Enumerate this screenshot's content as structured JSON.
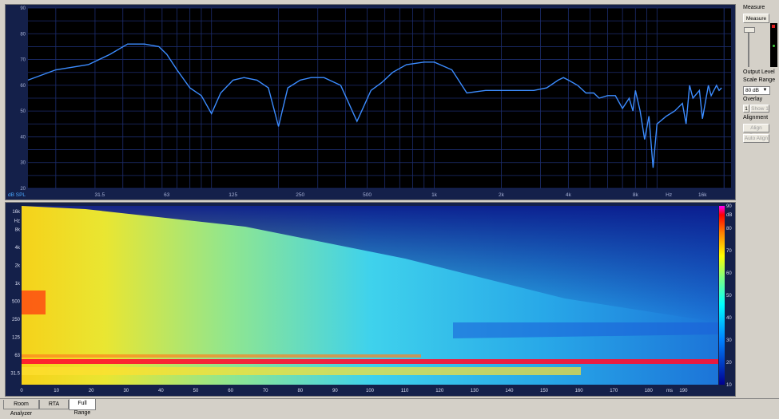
{
  "frequency_chart": {
    "ylabel": "dB SPL",
    "y_ticks": [
      "90",
      "80",
      "70",
      "60",
      "50",
      "40",
      "30",
      "20"
    ],
    "x_ticks": [
      "31.5",
      "63",
      "125",
      "250",
      "500",
      "1k",
      "2k",
      "4k",
      "8k",
      "Hz",
      "16k"
    ],
    "line_color": "#3c8cff"
  },
  "spectrogram": {
    "y_ticks": [
      "16k",
      "Hz",
      "8k",
      "4k",
      "2k",
      "1k",
      "500",
      "250",
      "125",
      "63",
      "31.5"
    ],
    "x_ticks": [
      "0",
      "10",
      "20",
      "30",
      "40",
      "50",
      "60",
      "70",
      "80",
      "90",
      "100",
      "110",
      "120",
      "130",
      "140",
      "150",
      "160",
      "170",
      "180",
      "ms",
      "190"
    ],
    "colorbar_ticks": [
      "90",
      "dB",
      "80",
      "70",
      "60",
      "50",
      "40",
      "30",
      "20",
      "10"
    ]
  },
  "chart_data": [
    {
      "type": "line",
      "title": "",
      "xlabel": "Hz",
      "ylabel": "dB SPL",
      "ylim": [
        20,
        90
      ],
      "x_scale": "log",
      "x": [
        15,
        20,
        28,
        35,
        42,
        50,
        58,
        63,
        70,
        80,
        90,
        100,
        110,
        125,
        140,
        160,
        180,
        200,
        220,
        250,
        280,
        320,
        380,
        450,
        520,
        580,
        650,
        750,
        900,
        1000,
        1200,
        1400,
        1700,
        2000,
        2400,
        2800,
        3200,
        3600,
        3800,
        4000,
        4400,
        4800,
        5000,
        5200,
        5500,
        6000,
        6500,
        7000,
        7500,
        7800,
        8000,
        8400,
        8800,
        9200,
        9600,
        10000,
        11000,
        12000,
        13000,
        13500,
        14000,
        14500,
        15500,
        16000,
        17000,
        17500,
        18500,
        19000,
        19500
      ],
      "values": [
        62,
        66,
        68,
        72,
        76,
        76,
        75,
        72,
        66,
        59,
        56,
        49,
        57,
        62,
        63,
        62,
        59,
        44,
        59,
        62,
        63,
        63,
        60,
        46,
        58,
        61,
        65,
        68,
        69,
        69,
        66,
        57,
        58,
        58,
        58,
        58,
        59,
        62,
        63,
        62,
        60,
        57,
        57,
        57,
        55,
        56,
        56,
        51,
        55,
        50,
        58,
        50,
        39,
        48,
        28,
        45,
        48,
        50,
        53,
        45,
        60,
        55,
        58,
        47,
        60,
        56,
        60,
        58,
        59
      ],
      "grid": true
    },
    {
      "type": "heatmap",
      "title": "",
      "xlabel": "ms",
      "ylabel": "Hz",
      "x_range": [
        0,
        200
      ],
      "y_range": [
        20,
        20000
      ],
      "y_scale": "log",
      "colorbar_label": "dB",
      "colorbar_range": [
        10,
        90
      ]
    }
  ],
  "sidebar": {
    "measure_label": "Measure",
    "measure_button": "Measure",
    "output_level_label": "Output Level",
    "scale_range_label": "Scale Range",
    "scale_range_value": "80 dB",
    "overlay_label": "Overlay",
    "overlay_index": "1",
    "show_button": "Show 1",
    "alignment_label": "Alignment",
    "align_delay_button": "Align Delay",
    "auto_align_button": "Auto Align"
  },
  "tabs": [
    {
      "label": "Room Analyzer"
    },
    {
      "label": "RTA"
    },
    {
      "label": "Full Range"
    }
  ]
}
